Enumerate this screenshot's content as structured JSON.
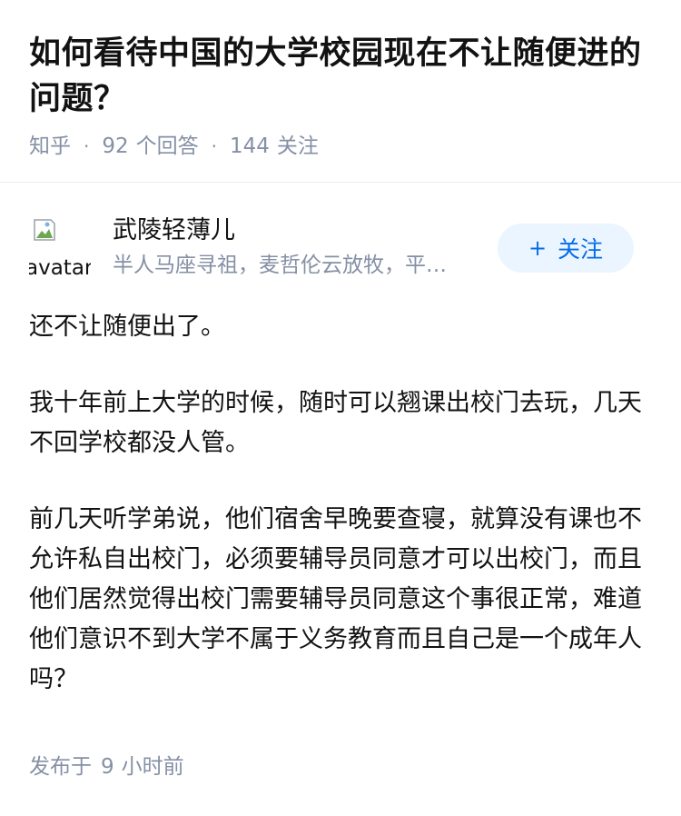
{
  "question": {
    "title": "如何看待中国的大学校园现在不让随便进的问题？",
    "source": "知乎",
    "answer_count": "92",
    "answer_count_label": "个回答",
    "follow_count": "144",
    "follow_count_label": "关注"
  },
  "answer": {
    "author": {
      "avatar_alt": "avatar",
      "name": "武陵轻薄儿",
      "bio": "半人马座寻祖，麦哲伦云放牧，平…"
    },
    "follow_button_label": "关注",
    "paragraphs": [
      "还不让随便出了。",
      "我十年前上大学的时候，随时可以翘课出校门去玩，几天不回学校都没人管。",
      "前几天听学弟说，他们宿舍早晚要查寝，就算没有课也不允许私自出校门，必须要辅导员同意才可以出校门，而且他们居然觉得出校门需要辅导员同意这个事很正常，难道他们意识不到大学不属于义务教育而且自己是一个成年人吗？"
    ],
    "time_prefix": "发布于",
    "time_value": "9",
    "time_unit": "小时前"
  },
  "colors": {
    "title": "#121212",
    "meta": "#8590a6",
    "accent": "#056de8",
    "follow_bg": "#ebf5ff",
    "divider": "#ebebeb"
  },
  "icons": {
    "avatar": "broken-image-icon",
    "follow": "plus-icon"
  }
}
